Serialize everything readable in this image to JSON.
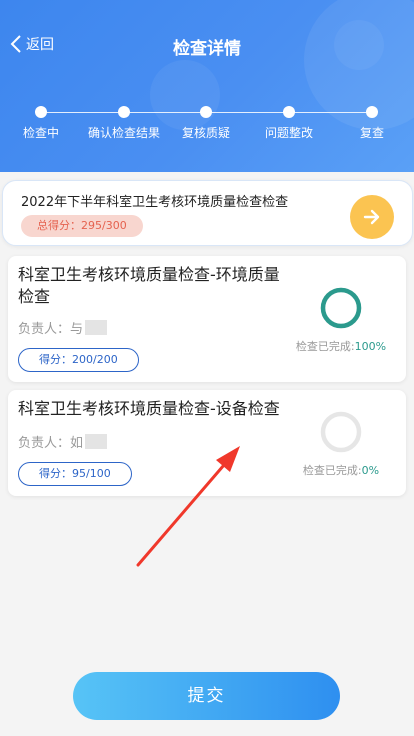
{
  "header": {
    "back_label": "返回",
    "title": "检查详情",
    "steps": [
      "检查中",
      "确认检查结果",
      "复核质疑",
      "问题整改",
      "复查"
    ]
  },
  "summary": {
    "title": "2022年下半年科室卫生考核环境质量检查检查",
    "score": "总得分：295/300"
  },
  "items": [
    {
      "title": "科室卫生考核环境质量检查-环境质量检查",
      "owner_label": "负责人：",
      "owner_initial": "与",
      "score": "得分：200/200",
      "progress_label": "检查已完成:",
      "progress_value": "100%",
      "progress": 1.0
    },
    {
      "title": "科室卫生考核环境质量检查-设备检查",
      "owner_label": "负责人：",
      "owner_initial": "如",
      "score": "得分：95/100",
      "progress_label": "检查已完成:",
      "progress_value": "0%",
      "progress": 0.0
    }
  ],
  "submit_label": "提交",
  "colors": {
    "header": "#4a8ff2",
    "ring_complete": "#2b9a8d",
    "ring_empty": "#e6e6e6",
    "score_badge_text": "#e5624f",
    "arrow_button": "#fbc451",
    "pill_border": "#2d65c8"
  },
  "icons": {
    "back": "chevron-left-icon",
    "next": "arrow-right-icon"
  }
}
